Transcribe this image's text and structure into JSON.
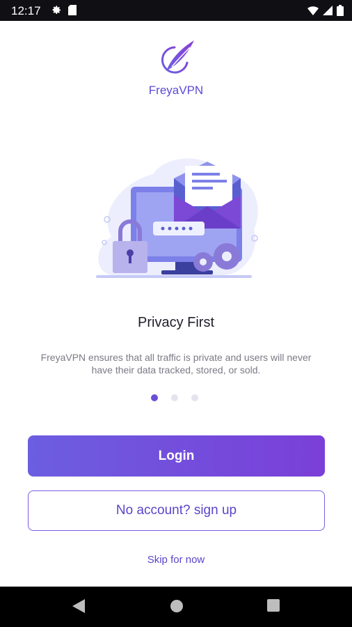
{
  "status_bar": {
    "time": "12:17",
    "icons": [
      "gear-icon",
      "sd-card-icon",
      "wifi-icon",
      "signal-icon",
      "battery-icon"
    ]
  },
  "app": {
    "brand_name": "FreyaVPN",
    "logo_icon": "feather-logo-icon",
    "illustration": "monitor-mail-lock-illustration",
    "onboarding": {
      "title": "Privacy First",
      "description": "FreyaVPN ensures that all traffic is private and users will never have  their data tracked, stored, or sold.",
      "page_count": 3,
      "active_page": 1
    },
    "login_label": "Login",
    "signup_label": "No account? sign up",
    "skip_label": "Skip for now"
  },
  "colors": {
    "accent": "#6a4fd6",
    "login_gradient_start": "#6c5ee0",
    "login_gradient_end": "#7a3fd8",
    "brand_text": "#5b4bd4"
  },
  "nav_bar": {
    "icons": [
      "back-icon",
      "home-icon",
      "recents-icon"
    ]
  }
}
